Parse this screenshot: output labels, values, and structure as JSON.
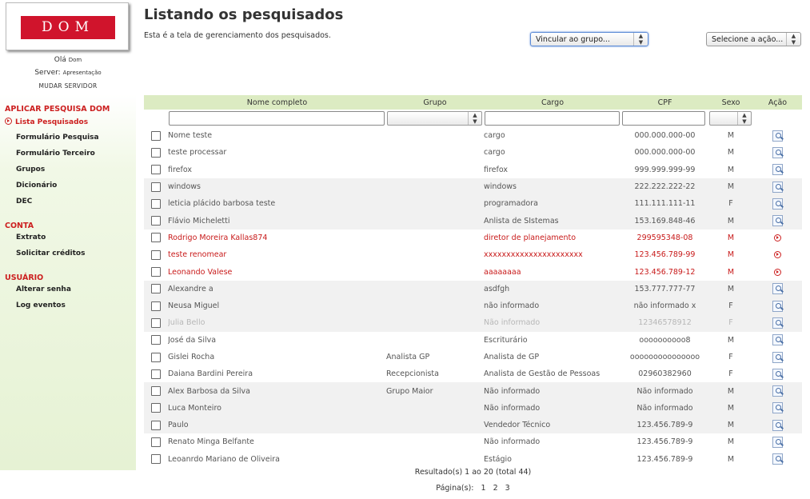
{
  "sidebar": {
    "logo_text": "DOM",
    "greeting_prefix": "Olá",
    "greeting_name": "Dom",
    "server_prefix": "Server:",
    "server_name": "Apresentação",
    "change_server": "MUDAR SERVIDOR",
    "sections": [
      {
        "title": "APLICAR PESQUISA DOM",
        "items": [
          "Lista Pesquisados",
          "Formulário Pesquisa",
          "Formulário Terceiro",
          "Grupos",
          "Dicionário",
          "DEC"
        ]
      },
      {
        "title": "CONTA",
        "items": [
          "Extrato",
          "Solicitar créditos"
        ]
      },
      {
        "title": "USUÁRIO",
        "items": [
          "Alterar senha",
          "Log eventos"
        ]
      }
    ]
  },
  "header": {
    "title": "Listando os pesquisados",
    "subtitle": "Esta é a tela de gerenciamento dos pesquisados.",
    "group_select": "Vincular ao grupo...",
    "action_select": "Selecione a ação..."
  },
  "table": {
    "columns": [
      "Nome completo",
      "Grupo",
      "Cargo",
      "CPF",
      "Sexo",
      "Ação"
    ],
    "rows": [
      {
        "nome": "Nome teste",
        "grupo": "",
        "cargo": "cargo",
        "cpf": "000.000.000-00",
        "sexo": "M",
        "acao": "view",
        "state": "normal"
      },
      {
        "nome": "teste processar",
        "grupo": "",
        "cargo": "cargo",
        "cpf": "000.000.000-00",
        "sexo": "M",
        "acao": "view",
        "state": "normal"
      },
      {
        "nome": "firefox",
        "grupo": "",
        "cargo": "firefox",
        "cpf": "999.999.999-99",
        "sexo": "M",
        "acao": "view",
        "state": "normal"
      },
      {
        "nome": "windows",
        "grupo": "",
        "cargo": "windows",
        "cpf": "222.222.222-22",
        "sexo": "M",
        "acao": "view",
        "state": "normal"
      },
      {
        "nome": "leticia plácido barbosa teste",
        "grupo": "",
        "cargo": "programadora",
        "cpf": "111.111.111-11",
        "sexo": "F",
        "acao": "view",
        "state": "normal"
      },
      {
        "nome": "Flávio Micheletti",
        "grupo": "",
        "cargo": "Anlista de SIstemas",
        "cpf": "153.169.848-46",
        "sexo": "M",
        "acao": "view",
        "state": "normal"
      },
      {
        "nome": "Rodrigo Moreira Kallas874",
        "grupo": "",
        "cargo": "diretor de planejamento",
        "cpf": "299595348-08",
        "sexo": "M",
        "acao": "play",
        "state": "red"
      },
      {
        "nome": "teste renomear",
        "grupo": "",
        "cargo": "xxxxxxxxxxxxxxxxxxxxxx",
        "cpf": "123.456.789-99",
        "sexo": "M",
        "acao": "play",
        "state": "red"
      },
      {
        "nome": "Leonando Valese",
        "grupo": "",
        "cargo": "aaaaaaaa",
        "cpf": "123.456.789-12",
        "sexo": "M",
        "acao": "play",
        "state": "red"
      },
      {
        "nome": "Alexandre a",
        "grupo": "",
        "cargo": "asdfgh",
        "cpf": "153.777.777-77",
        "sexo": "M",
        "acao": "view",
        "state": "normal"
      },
      {
        "nome": "Neusa Miguel",
        "grupo": "",
        "cargo": "não informado",
        "cpf": "não informado x",
        "sexo": "F",
        "acao": "view",
        "state": "normal"
      },
      {
        "nome": "Julia Bello",
        "grupo": "",
        "cargo": "Não informado",
        "cpf": "12346578912",
        "sexo": "F",
        "acao": "view",
        "state": "faded"
      },
      {
        "nome": "José da Silva",
        "grupo": "",
        "cargo": "Escriturário",
        "cpf": "oooooooooo8",
        "sexo": "M",
        "acao": "view",
        "state": "normal"
      },
      {
        "nome": "Gislei Rocha",
        "grupo": "Analista GP",
        "cargo": "Analista de GP",
        "cpf": "ooooooooooooooo",
        "sexo": "F",
        "acao": "view",
        "state": "normal"
      },
      {
        "nome": "Daiana Bardini Pereira",
        "grupo": "Recepcionista",
        "cargo": "Analista de Gestão de Pessoas",
        "cpf": "02960382960",
        "sexo": "F",
        "acao": "view",
        "state": "normal"
      },
      {
        "nome": "Alex Barbosa da Silva",
        "grupo": "Grupo Maior",
        "cargo": "Não informado",
        "cpf": "Não informado",
        "sexo": "M",
        "acao": "view",
        "state": "normal"
      },
      {
        "nome": "Luca Monteiro",
        "grupo": "",
        "cargo": "Não informado",
        "cpf": "Não informado",
        "sexo": "M",
        "acao": "view",
        "state": "normal"
      },
      {
        "nome": "Paulo",
        "grupo": "",
        "cargo": "Vendedor Técnico",
        "cpf": "123.456.789-9",
        "sexo": "M",
        "acao": "view",
        "state": "normal"
      },
      {
        "nome": "Renato Minga Belfante",
        "grupo": "",
        "cargo": "Não informado",
        "cpf": "123.456.789-9",
        "sexo": "M",
        "acao": "view",
        "state": "normal"
      },
      {
        "nome": "Leoanrdo Mariano de Oliveira",
        "grupo": "",
        "cargo": "Estágio",
        "cpf": "123.456.789-9",
        "sexo": "M",
        "acao": "view",
        "state": "normal"
      }
    ]
  },
  "footer": {
    "results": "Resultado(s) 1 ao 20 (total 44)",
    "pages_label": "Página(s):",
    "pages": [
      "1",
      "2",
      "3"
    ]
  },
  "colors": {
    "accent_red": "#cc1f1f",
    "header_green": "#dcebc2",
    "sidebar_green": "#e6f2d4",
    "logo_red": "#d0142c"
  }
}
